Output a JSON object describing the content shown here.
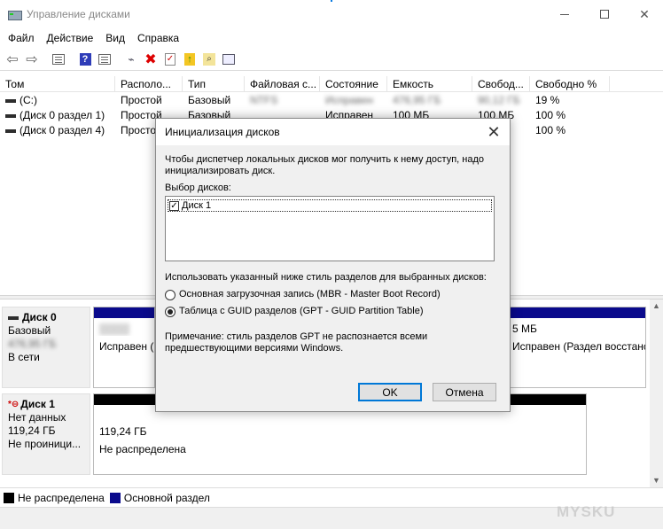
{
  "window": {
    "title": "Управление дисками"
  },
  "menu": [
    "Файл",
    "Действие",
    "Вид",
    "Справка"
  ],
  "toolbar": {
    "icons": [
      "back-arrow",
      "forward-arrow",
      "properties",
      "help",
      "details",
      "connect",
      "delete",
      "check",
      "up-folder",
      "search",
      "list"
    ]
  },
  "volumes": {
    "columns": [
      "Том",
      "Располо...",
      "Тип",
      "Файловая с...",
      "Состояние",
      "Емкость",
      "Свобод...",
      "Свободно %"
    ],
    "rows": [
      {
        "tom": "(C:)",
        "loc": "Простой",
        "type": "Базовый",
        "fs": "NTFS",
        "state": "Исправен",
        "cap": "476,95 ГБ",
        "free": "90,12 ГБ",
        "pct": "19 %"
      },
      {
        "tom": "(Диск 0 раздел 1)",
        "loc": "Простой",
        "type": "Базовый",
        "fs": "",
        "state": "Исправен",
        "cap": "100 МБ",
        "free": "100 МБ",
        "pct": "100 %"
      },
      {
        "tom": "(Диск 0 раздел 4)",
        "loc": "Простой",
        "type": "",
        "fs": "",
        "state": "",
        "cap": "",
        "free": "",
        "pct": "100 %"
      }
    ]
  },
  "disks": [
    {
      "name": "Диск 0",
      "kind": "Базовый",
      "size": "476,95 ГБ",
      "status": "В сети",
      "part_left": "Исправен (",
      "part_right": "Исправен (Раздел восстанс",
      "part_right_size": "5 МБ"
    },
    {
      "name": "Диск 1",
      "kind": "Нет данных",
      "size": "119,24 ГБ",
      "status": "Не проиници...",
      "part_size": "119,24 ГБ",
      "part_state": "Не распределена"
    }
  ],
  "legend": {
    "unallocated": "Не распределена",
    "primary": "Основной раздел"
  },
  "watermark": "MYSKU",
  "dialog": {
    "title": "Инициализация дисков",
    "intro": "Чтобы диспетчер локальных дисков мог получить к нему доступ, надо инициализировать диск.",
    "select_label": "Выбор дисков:",
    "disk_item": "Диск 1",
    "style_label": "Использовать указанный ниже стиль разделов для выбранных дисков:",
    "mbr": "Основная загрузочная запись (MBR - Master Boot Record)",
    "gpt": "Таблица с GUID разделов (GPT - GUID Partition Table)",
    "note": "Примечание: стиль разделов GPT не распознается всеми предшествующими версиями Windows.",
    "ok": "OK",
    "cancel": "Отмена"
  },
  "colors": {
    "primary_partition": "#0a0a8c",
    "unallocated": "#000000",
    "ok_border": "#0078d7"
  }
}
